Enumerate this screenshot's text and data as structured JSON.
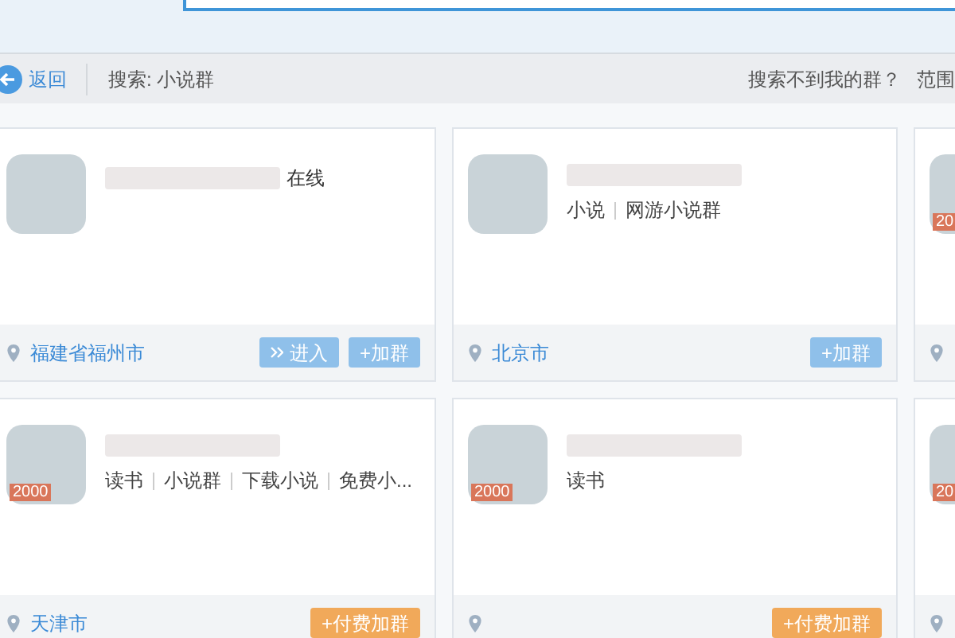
{
  "toolbar": {
    "back_label": "返回",
    "query": "搜索: 小说群",
    "help_link": "搜索不到我的群？",
    "scope": "范围"
  },
  "cards": [
    {
      "name_fragment": "在线",
      "location": "福建省福州市",
      "buttons": [
        {
          "kind": "enter",
          "label": "进入"
        },
        {
          "kind": "join",
          "label": "+加群"
        }
      ]
    },
    {
      "tags": [
        "小说",
        "网游小说群"
      ],
      "location": "北京市",
      "buttons": [
        {
          "kind": "join",
          "label": "+加群"
        }
      ]
    },
    {
      "badge": "20"
    },
    {
      "badge": "2000",
      "tags": [
        "读书",
        "小说群",
        "下载小说",
        "免费小..."
      ],
      "location": "天津市",
      "buttons": [
        {
          "kind": "paid",
          "label": "+付费加群"
        }
      ]
    },
    {
      "badge": "2000",
      "tags": [
        "读书"
      ],
      "buttons": [
        {
          "kind": "paid",
          "label": "+付费加群"
        }
      ]
    },
    {
      "badge": "20"
    }
  ]
}
